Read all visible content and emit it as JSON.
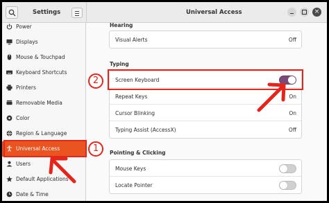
{
  "window": {
    "settings_title": "Settings",
    "page_title": "Universal Access",
    "close_glyph": "×"
  },
  "sidebar": {
    "items": [
      {
        "label": "Power",
        "icon": "power-icon"
      },
      {
        "label": "Displays",
        "icon": "display-icon"
      },
      {
        "label": "Mouse & Touchpad",
        "icon": "mouse-icon"
      },
      {
        "label": "Keyboard Shortcuts",
        "icon": "keyboard-icon"
      },
      {
        "label": "Printers",
        "icon": "printer-icon"
      },
      {
        "label": "Removable Media",
        "icon": "removable-media-icon"
      },
      {
        "label": "Color",
        "icon": "color-icon"
      },
      {
        "label": "Region & Language",
        "icon": "globe-icon"
      },
      {
        "label": "Universal Access",
        "icon": "accessibility-icon",
        "active": true
      },
      {
        "label": "Users",
        "icon": "users-icon"
      },
      {
        "label": "Default Applications",
        "icon": "star-icon"
      },
      {
        "label": "Date & Time",
        "icon": "clock-icon"
      }
    ]
  },
  "sections": {
    "hearing": {
      "title": "Hearing",
      "rows": [
        {
          "label": "Visual Alerts",
          "value": "Off"
        }
      ]
    },
    "typing": {
      "title": "Typing",
      "rows": [
        {
          "label": "Screen Keyboard",
          "toggle": true
        },
        {
          "label": "Repeat Keys",
          "value": "On"
        },
        {
          "label": "Cursor Blinking",
          "value": "On"
        },
        {
          "label": "Typing Assist (AccessX)",
          "value": "Off"
        }
      ]
    },
    "pointing": {
      "title": "Pointing & Clicking",
      "rows": [
        {
          "label": "Mouse Keys",
          "toggle": false
        },
        {
          "label": "Locate Pointer",
          "toggle": false
        }
      ]
    }
  },
  "annotations": {
    "step1": "1",
    "step2": "2",
    "color": "#e4251b"
  },
  "colors": {
    "accent": "#e95420",
    "toggle_on": "#7a4a76"
  }
}
